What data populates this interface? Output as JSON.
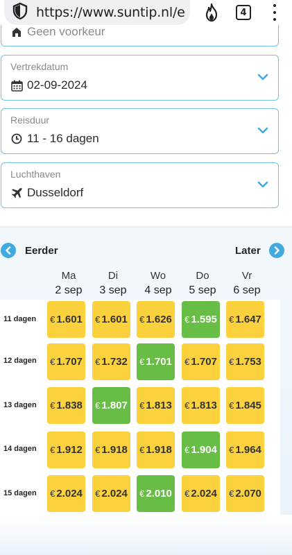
{
  "browser": {
    "url": "https://www.suntip.nl/e",
    "tab_count": "4",
    "icons": {
      "site": "shield-icon",
      "fire": "flame-icon",
      "menu": "kebab-menu-icon"
    }
  },
  "form": {
    "board": {
      "value": "Geen voorkeur",
      "icon": "house-icon"
    },
    "departure": {
      "label": "Vertrekdatum",
      "value": "02-09-2024",
      "icon": "calendar-icon"
    },
    "duration": {
      "label": "Reisduur",
      "value": "11 - 16 dagen",
      "icon": "clock-icon"
    },
    "airport": {
      "label": "Luchthaven",
      "value": "Dusseldorf",
      "icon": "plane-icon"
    }
  },
  "calendar": {
    "prev_label": "Eerder",
    "next_label": "Later",
    "currency": "€",
    "days": [
      {
        "name": "Ma",
        "date": "2 sep"
      },
      {
        "name": "Di",
        "date": "3 sep"
      },
      {
        "name": "Wo",
        "date": "4 sep"
      },
      {
        "name": "Do",
        "date": "5 sep"
      },
      {
        "name": "Vr",
        "date": "6 sep"
      }
    ],
    "rows": [
      {
        "label": "11 dagen",
        "prices": [
          "1.601",
          "1.601",
          "1.626",
          "1.595",
          "1.647"
        ],
        "best": 3
      },
      {
        "label": "12 dagen",
        "prices": [
          "1.707",
          "1.732",
          "1.701",
          "1.707",
          "1.753"
        ],
        "best": 2
      },
      {
        "label": "13 dagen",
        "prices": [
          "1.838",
          "1.807",
          "1.813",
          "1.813",
          "1.845"
        ],
        "best": 1
      },
      {
        "label": "14 dagen",
        "prices": [
          "1.912",
          "1.918",
          "1.918",
          "1.904",
          "1.964"
        ],
        "best": 3
      },
      {
        "label": "15 dagen",
        "prices": [
          "2.024",
          "2.024",
          "2.010",
          "2.024",
          "2.070"
        ],
        "best": 2
      }
    ],
    "colors": {
      "cheapest": "#67bd45",
      "regular": "#fbd13d",
      "accent": "#41aae0"
    }
  }
}
